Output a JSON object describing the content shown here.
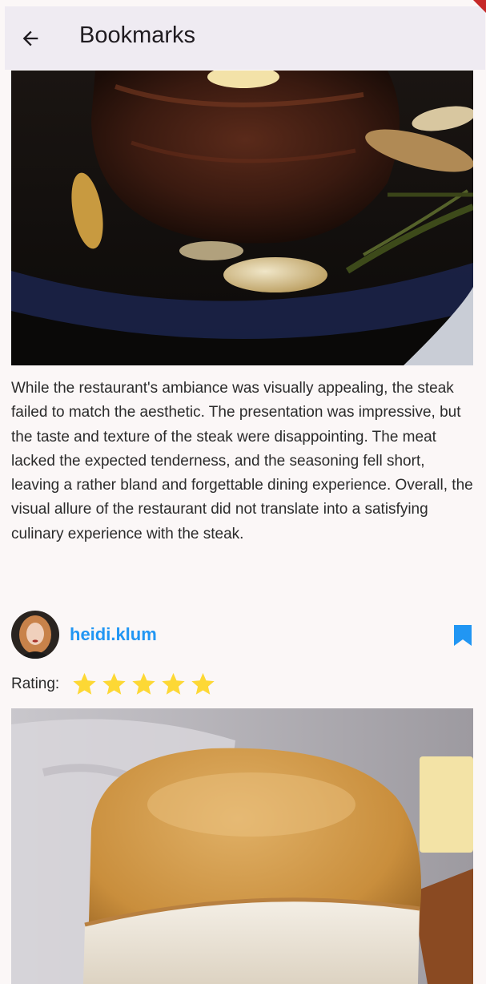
{
  "app_bar": {
    "title": "Bookmarks",
    "back_icon": "arrow-back-icon"
  },
  "posts": [
    {
      "image": "steak-photo",
      "review": "While the restaurant's ambiance was visually appealing, the steak failed to match the aesthetic. The presentation was impressive, but the taste and texture of the steak were disappointing. The meat lacked the expected tenderness, and the seasoning fell short, leaving a rather bland and forgettable dining experience. Overall, the visual allure of the restaurant did not translate into a satisfying culinary experience with the steak.",
      "author": "heidi.klum",
      "bookmarked": true,
      "rating_label": "Rating:",
      "rating": 5,
      "rating_max": 5
    },
    {
      "image": "bread-photo"
    }
  ],
  "colors": {
    "background": "#fbf7f7",
    "app_bar": "#efebf2",
    "accent": "#2196f3",
    "star": "#fdd835",
    "text": "#2b2b2b"
  }
}
